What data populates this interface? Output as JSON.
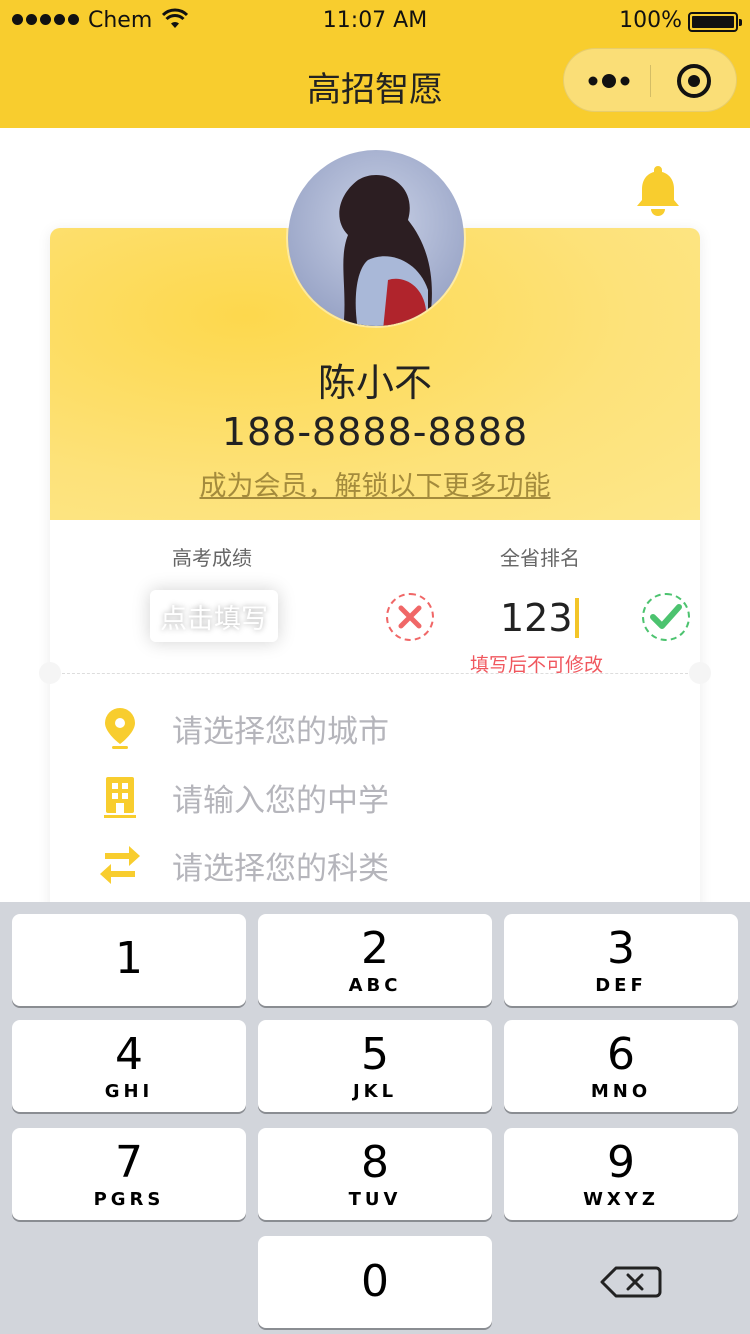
{
  "status_bar": {
    "carrier": "Chem",
    "time": "11:07 AM",
    "battery": "100%"
  },
  "nav": {
    "title": "高招智愿"
  },
  "profile": {
    "name": "陈小不",
    "phone": "188-8888-8888",
    "member_link": "成为会员，解锁以下更多功能"
  },
  "score": {
    "label": "高考成绩",
    "placeholder": "点击填写"
  },
  "rank": {
    "label": "全省排名",
    "value": "123",
    "hint": "填写后不可修改"
  },
  "form_rows": [
    {
      "icon": "location-pin-icon",
      "text": "请选择您的城市"
    },
    {
      "icon": "building-icon",
      "text": "请输入您的中学"
    },
    {
      "icon": "swap-arrows-icon",
      "text": "请选择您的科类"
    }
  ],
  "keypad": [
    {
      "num": "1",
      "letters": ""
    },
    {
      "num": "2",
      "letters": "ABC"
    },
    {
      "num": "3",
      "letters": "DEF"
    },
    {
      "num": "4",
      "letters": "GHI"
    },
    {
      "num": "5",
      "letters": "JKL"
    },
    {
      "num": "6",
      "letters": "MNO"
    },
    {
      "num": "7",
      "letters": "PGRS"
    },
    {
      "num": "8",
      "letters": "TUV"
    },
    {
      "num": "9",
      "letters": "WXYZ"
    },
    {
      "num": "0",
      "letters": ""
    }
  ],
  "colors": {
    "brand_yellow": "#f8cd2e",
    "danger": "#f06767",
    "success": "#4cc36f"
  }
}
